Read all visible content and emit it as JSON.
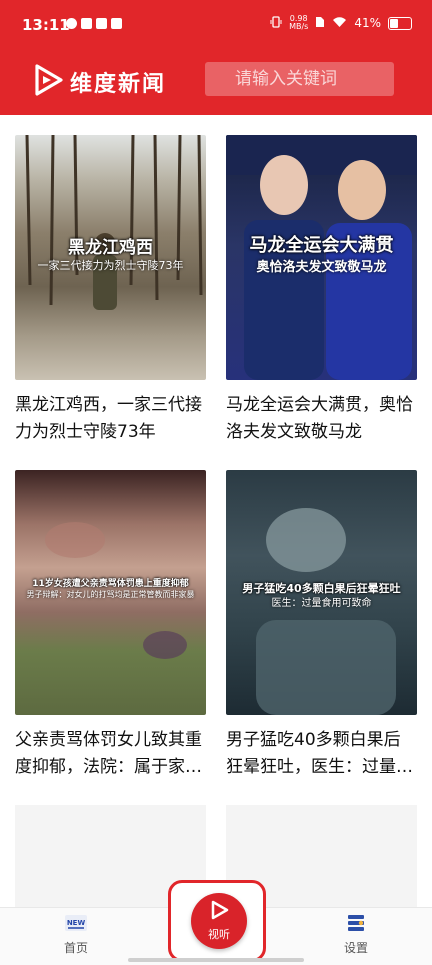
{
  "status_bar": {
    "time": "13:11",
    "net_speed_value": "0.98",
    "net_speed_unit": "MB/s",
    "battery": "41%"
  },
  "header": {
    "app_name": "维度新闻",
    "search_placeholder": "请输入关键词"
  },
  "articles": [
    {
      "title": "黑龙江鸡西，一家三代接力为烈士守陵73年",
      "thumb_caption": "黑龙江鸡西",
      "thumb_subcaption": "一家三代接力为烈士守陵73年"
    },
    {
      "title": "马龙全运会大满贯，奥恰洛夫发文致敬马龙",
      "thumb_caption": "马龙全运会大满贯",
      "thumb_subcaption": "奥恰洛夫发文致敬马龙"
    },
    {
      "title": "父亲责骂体罚女儿致其重度抑郁，法院：属于家…",
      "thumb_caption": "11岁女孩遭父亲责骂体罚患上重度抑郁",
      "thumb_subcaption": "男子辩解：对女儿的打骂均是正常管教而非家暴"
    },
    {
      "title": "男子猛吃40多颗白果后狂晕狂吐，医生：过量…",
      "thumb_caption": "男子猛吃40多颗白果后狂晕狂吐",
      "thumb_subcaption": "医生：过量食用可致命"
    }
  ],
  "tabs": {
    "home": "首页",
    "video": "视听",
    "settings": "设置",
    "home_badge": "NEW"
  },
  "colors": {
    "brand_red": "#e1262a"
  }
}
